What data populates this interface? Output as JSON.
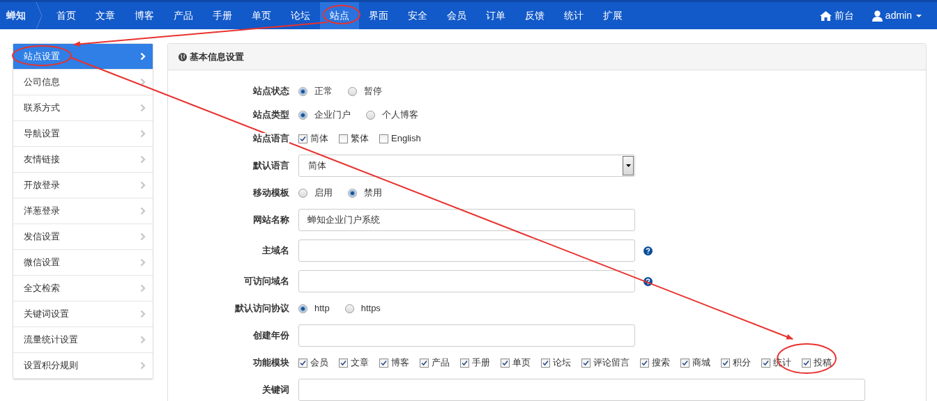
{
  "navbar": {
    "brand": "蝉知",
    "items": [
      {
        "label": "首页",
        "selected": false
      },
      {
        "label": "文章",
        "selected": false
      },
      {
        "label": "博客",
        "selected": false
      },
      {
        "label": "产品",
        "selected": false
      },
      {
        "label": "手册",
        "selected": false
      },
      {
        "label": "单页",
        "selected": false
      },
      {
        "label": "论坛",
        "selected": false
      },
      {
        "label": "站点",
        "selected": true
      },
      {
        "label": "界面",
        "selected": false
      },
      {
        "label": "安全",
        "selected": false
      },
      {
        "label": "会员",
        "selected": false
      },
      {
        "label": "订单",
        "selected": false
      },
      {
        "label": "反馈",
        "selected": false
      },
      {
        "label": "统计",
        "selected": false
      },
      {
        "label": "扩展",
        "selected": false
      }
    ],
    "frontend_link": "前台",
    "user": "admin"
  },
  "sidebar": {
    "items": [
      {
        "label": "站点设置",
        "selected": true
      },
      {
        "label": "公司信息",
        "selected": false
      },
      {
        "label": "联系方式",
        "selected": false
      },
      {
        "label": "导航设置",
        "selected": false
      },
      {
        "label": "友情链接",
        "selected": false
      },
      {
        "label": "开放登录",
        "selected": false
      },
      {
        "label": "洋葱登录",
        "selected": false
      },
      {
        "label": "发信设置",
        "selected": false
      },
      {
        "label": "微信设置",
        "selected": false
      },
      {
        "label": "全文检索",
        "selected": false
      },
      {
        "label": "关键词设置",
        "selected": false
      },
      {
        "label": "流量统计设置",
        "selected": false
      },
      {
        "label": "设置积分规则",
        "selected": false
      }
    ]
  },
  "panel": {
    "title": "基本信息设置",
    "fields": [
      {
        "kind": "radio",
        "label": "站点状态",
        "options": [
          {
            "label": "正常",
            "selected": true
          },
          {
            "label": "暂停",
            "selected": false
          }
        ]
      },
      {
        "kind": "radio",
        "label": "站点类型",
        "options": [
          {
            "label": "企业门户",
            "selected": true
          },
          {
            "label": "个人博客",
            "selected": false
          }
        ]
      },
      {
        "kind": "checkbox",
        "label": "站点语言",
        "options": [
          {
            "label": "简体",
            "checked": true
          },
          {
            "label": "繁体",
            "checked": false
          },
          {
            "label": "English",
            "checked": false
          }
        ]
      },
      {
        "kind": "select",
        "label": "默认语言",
        "value": "简体"
      },
      {
        "kind": "radio",
        "label": "移动模板",
        "options": [
          {
            "label": "启用",
            "selected": false
          },
          {
            "label": "禁用",
            "selected": true
          }
        ]
      },
      {
        "kind": "text",
        "label": "网站名称",
        "value": "蝉知企业门户系统",
        "help": false
      },
      {
        "kind": "text",
        "label": "主域名",
        "help": true
      },
      {
        "kind": "text",
        "label": "可访问域名",
        "help": true
      },
      {
        "kind": "radio",
        "label": "默认访问协议",
        "options": [
          {
            "label": "http",
            "selected": true
          },
          {
            "label": "https",
            "selected": false
          }
        ]
      },
      {
        "kind": "text",
        "label": "创建年份",
        "help": false
      },
      {
        "kind": "checkbox",
        "label": "功能模块",
        "options": [
          {
            "label": "会员",
            "checked": true
          },
          {
            "label": "文章",
            "checked": true
          },
          {
            "label": "博客",
            "checked": true
          },
          {
            "label": "产品",
            "checked": true
          },
          {
            "label": "手册",
            "checked": true
          },
          {
            "label": "单页",
            "checked": true
          },
          {
            "label": "论坛",
            "checked": true
          },
          {
            "label": "评论留言",
            "checked": true
          },
          {
            "label": "搜索",
            "checked": true
          },
          {
            "label": "商城",
            "checked": true
          },
          {
            "label": "积分",
            "checked": true
          },
          {
            "label": "统计",
            "checked": true
          },
          {
            "label": "投稿",
            "checked": true
          }
        ]
      },
      {
        "kind": "wide_text",
        "label": "关键词"
      }
    ]
  }
}
